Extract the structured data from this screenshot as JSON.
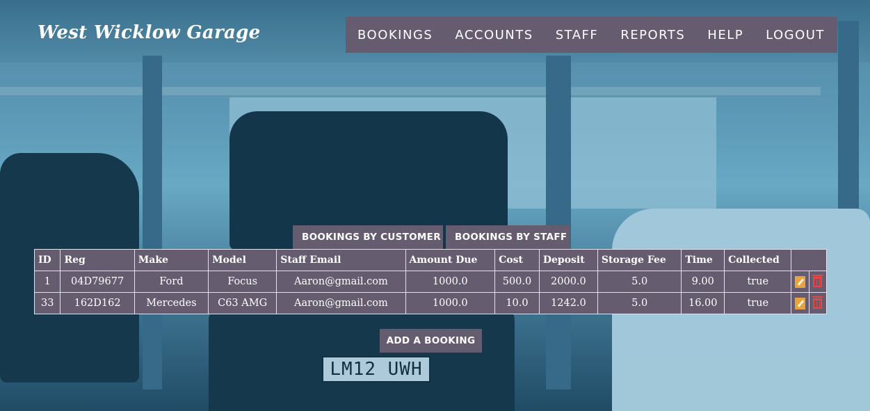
{
  "brand": "West Wicklow Garage",
  "nav": [
    "BOOKINGS",
    "ACCOUNTS",
    "STAFF",
    "REPORTS",
    "HELP",
    "LOGOUT"
  ],
  "tabs": {
    "by_customer": "BOOKINGS BY CUSTOMER",
    "by_staff": "BOOKINGS BY STAFF"
  },
  "table": {
    "headers": [
      "ID",
      "Reg",
      "Make",
      "Model",
      "Staff Email",
      "Amount Due",
      "Cost",
      "Deposit",
      "Storage Fee",
      "Time",
      "Collected"
    ],
    "rows": [
      [
        "1",
        "04D79677",
        "Ford",
        "Focus",
        "Aaron@gmail.com",
        "1000.0",
        "500.0",
        "2000.0",
        "5.0",
        "9.00",
        "true"
      ],
      [
        "33",
        "162D162",
        "Mercedes",
        "C63 AMG",
        "Aaron@gmail.com",
        "1000.0",
        "10.0",
        "1242.0",
        "5.0",
        "16.00",
        "true"
      ]
    ]
  },
  "add_button": "ADD A BOOKING",
  "background": {
    "plate_text": "LM12 UWH"
  },
  "colors": {
    "panel": "#655c70",
    "edit": "#e7a33e",
    "delete": "#e24848"
  },
  "icons": {
    "edit": "pencil-icon",
    "delete": "trash-icon"
  }
}
